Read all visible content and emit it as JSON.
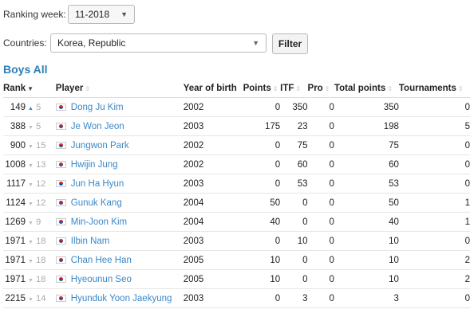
{
  "filters": {
    "week_label": "Ranking week:",
    "week_value": "11-2018",
    "country_label": "Countries:",
    "country_value": "Korea, Republic",
    "filter_button": "Filter"
  },
  "section_title": "Boys All",
  "table": {
    "headers": {
      "rank": "Rank",
      "player": "Player",
      "year": "Year of birth",
      "points": "Points",
      "itf": "ITF",
      "pro": "Pro",
      "total": "Total points",
      "tournaments": "Tournaments"
    },
    "rows": [
      {
        "rank": "149",
        "dir": "up",
        "move": "5",
        "player": "Dong Ju Kim",
        "year": "2002",
        "points": "0",
        "itf": "350",
        "pro": "0",
        "total": "350",
        "tournaments": "0"
      },
      {
        "rank": "388",
        "dir": "down",
        "move": "5",
        "player": "Je Won Jeon",
        "year": "2003",
        "points": "175",
        "itf": "23",
        "pro": "0",
        "total": "198",
        "tournaments": "5"
      },
      {
        "rank": "900",
        "dir": "down",
        "move": "15",
        "player": "Jungwon Park",
        "year": "2002",
        "points": "0",
        "itf": "75",
        "pro": "0",
        "total": "75",
        "tournaments": "0"
      },
      {
        "rank": "1008",
        "dir": "down",
        "move": "13",
        "player": "Hwijin Jung",
        "year": "2002",
        "points": "0",
        "itf": "60",
        "pro": "0",
        "total": "60",
        "tournaments": "0"
      },
      {
        "rank": "1117",
        "dir": "down",
        "move": "12",
        "player": "Jun Ha Hyun",
        "year": "2003",
        "points": "0",
        "itf": "53",
        "pro": "0",
        "total": "53",
        "tournaments": "0"
      },
      {
        "rank": "1124",
        "dir": "down",
        "move": "12",
        "player": "Gunuk Kang",
        "year": "2004",
        "points": "50",
        "itf": "0",
        "pro": "0",
        "total": "50",
        "tournaments": "1"
      },
      {
        "rank": "1269",
        "dir": "down",
        "move": "9",
        "player": "Min-Joon Kim",
        "year": "2004",
        "points": "40",
        "itf": "0",
        "pro": "0",
        "total": "40",
        "tournaments": "1"
      },
      {
        "rank": "1971",
        "dir": "down",
        "move": "18",
        "player": "Ilbin Nam",
        "year": "2003",
        "points": "0",
        "itf": "10",
        "pro": "0",
        "total": "10",
        "tournaments": "0"
      },
      {
        "rank": "1971",
        "dir": "down",
        "move": "18",
        "player": "Chan Hee Han",
        "year": "2005",
        "points": "10",
        "itf": "0",
        "pro": "0",
        "total": "10",
        "tournaments": "2"
      },
      {
        "rank": "1971",
        "dir": "down",
        "move": "18",
        "player": "Hyeounun Seo",
        "year": "2005",
        "points": "10",
        "itf": "0",
        "pro": "0",
        "total": "10",
        "tournaments": "2"
      },
      {
        "rank": "2215",
        "dir": "down",
        "move": "14",
        "player": "Hyunduk Yoon Jaekyung",
        "year": "2003",
        "points": "0",
        "itf": "3",
        "pro": "0",
        "total": "3",
        "tournaments": "0"
      }
    ]
  },
  "colors": {
    "accent": "#2d7fb8",
    "link": "#3a87c8",
    "up_arrow": "#2d8bcb",
    "down_arrow": "#bbbbbb"
  }
}
